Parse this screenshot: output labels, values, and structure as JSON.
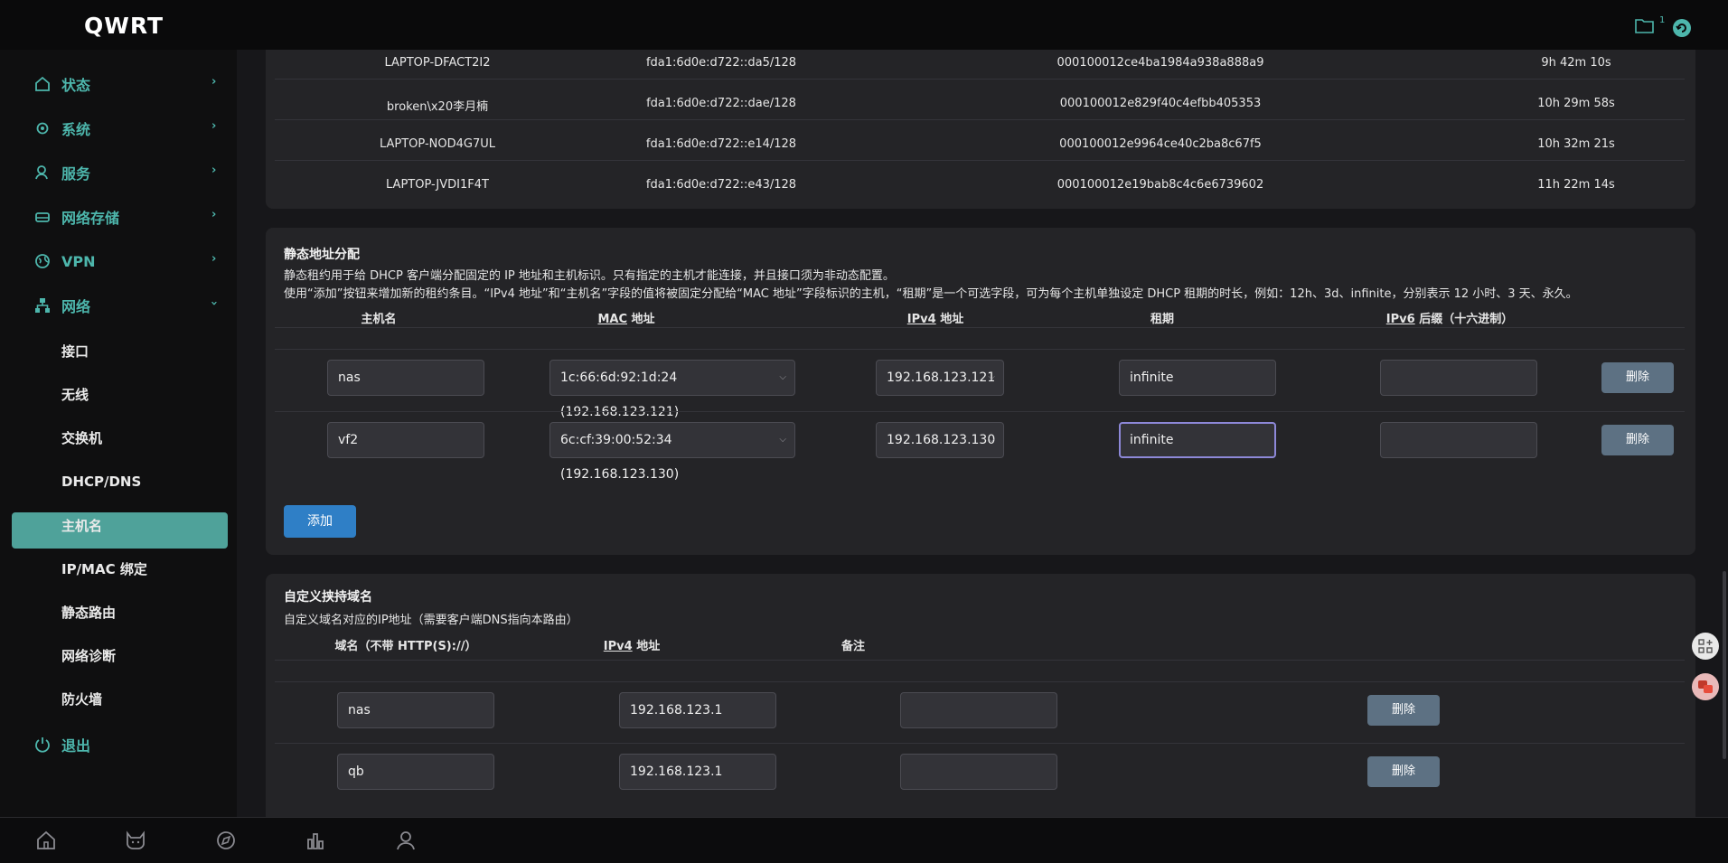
{
  "header": {
    "brand": "QWRT",
    "notification_count": "1"
  },
  "sidebar": {
    "top": [
      {
        "label": "状态",
        "icon": "home-icon"
      },
      {
        "label": "系统",
        "icon": "gear-icon"
      },
      {
        "label": "服务",
        "icon": "user-icon"
      },
      {
        "label": "网络存储",
        "icon": "drive-icon"
      },
      {
        "label": "VPN",
        "icon": "globe-icon"
      },
      {
        "label": "网络",
        "icon": "network-icon"
      }
    ],
    "sub": [
      "接口",
      "无线",
      "交换机",
      "DHCP/DNS",
      "主机名",
      "IP/MAC 绑定",
      "静态路由",
      "网络诊断",
      "防火墙"
    ],
    "logout": "退出"
  },
  "leases_v6": {
    "rows": [
      {
        "host": "LAPTOP-DFACT2I2",
        "ip": "fda1:6d0e:d722::da5/128",
        "duid": "000100012ce4ba1984a938a888a9",
        "remain": "9h 42m 10s"
      },
      {
        "host": "broken\\x20李月楠",
        "ip": "fda1:6d0e:d722::dae/128",
        "duid": "000100012e829f40c4efbb405353",
        "remain": "10h 29m 58s"
      },
      {
        "host": "LAPTOP-NOD4G7UL",
        "ip": "fda1:6d0e:d722::e14/128",
        "duid": "000100012e9964ce40c2ba8c67f5",
        "remain": "10h 32m 21s"
      },
      {
        "host": "LAPTOP-JVDI1F4T",
        "ip": "fda1:6d0e:d722::e43/128",
        "duid": "000100012e19bab8c4c6e6739602",
        "remain": "11h 22m 14s"
      }
    ]
  },
  "static": {
    "title": "静态地址分配",
    "desc1": "静态租约用于给 DHCP 客户端分配固定的 IP 地址和主机标识。只有指定的主机才能连接，并且接口须为非动态配置。",
    "desc2": "使用“添加”按钮来增加新的租约条目。“IPv4 地址”和“主机名”字段的值将被固定分配给“MAC 地址”字段标识的主机，“租期”是一个可选字段，可为每个主机单独设定 DHCP 租期的时长，例如：12h、3d、infinite，分别表示 12 小时、3 天、永久。",
    "headers": {
      "host": "主机名",
      "mac_abbr": "MAC",
      "mac_rest": " 地址",
      "ipv4_abbr": "IPv4",
      "ipv4_rest": " 地址",
      "lease": "租期",
      "ipv6_abbr": "IPv6",
      "ipv6_rest": " 后缀（十六进制）"
    },
    "rows": [
      {
        "host": "nas",
        "mac": "1c:66:6d:92:1d:24 (192.168.123.121)",
        "ip": "192.168.123.121",
        "lease": "infinite",
        "ipv6": ""
      },
      {
        "host": "vf2",
        "mac": "6c:cf:39:00:52:34 (192.168.123.130)",
        "ip": "192.168.123.130",
        "lease": "infinite",
        "ipv6": ""
      }
    ],
    "delete_label": "删除",
    "add_label": "添加"
  },
  "domains": {
    "title": "自定义挟持域名",
    "desc": "自定义域名对应的IP地址（需要客户端DNS指向本路由）",
    "headers": {
      "domain": "域名（不带 HTTP(S)://）",
      "ipv4_abbr": "IPv4",
      "ipv4_rest": " 地址",
      "note": "备注"
    },
    "rows": [
      {
        "domain": "nas",
        "ip": "192.168.123.1",
        "note": ""
      },
      {
        "domain": "qb",
        "ip": "192.168.123.1",
        "note": ""
      }
    ],
    "delete_label": "删除"
  },
  "bottombar": [
    "home-icon",
    "cat-icon",
    "compass-icon",
    "stats-icon",
    "user-icon"
  ]
}
